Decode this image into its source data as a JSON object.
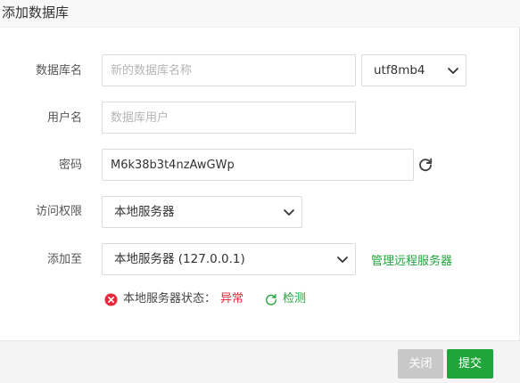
{
  "dialog": {
    "title": "添加数据库"
  },
  "form": {
    "db_name": {
      "label": "数据库名",
      "value": "",
      "placeholder": "新的数据库名称"
    },
    "charset": {
      "selected": "utf8mb4"
    },
    "username": {
      "label": "用户名",
      "value": "",
      "placeholder": "数据库用户"
    },
    "password": {
      "label": "密码",
      "value": "M6k38b3t4nzAwGWp"
    },
    "access": {
      "label": "访问权限",
      "selected": "本地服务器"
    },
    "add_to": {
      "label": "添加至",
      "selected": "本地服务器 (127.0.0.1)",
      "manage_link": "管理远程服务器"
    },
    "status": {
      "label": "本地服务器状态：",
      "value": "异常",
      "check_link": "检测"
    }
  },
  "footer": {
    "close_label": "关闭",
    "submit_label": "提交"
  },
  "colors": {
    "accent_green": "#20a53a",
    "error_red": "#e8283c",
    "disabled_gray": "#c8c8c8"
  },
  "icons": {
    "select_arrow": "chevron-down-icon",
    "refresh": "refresh-icon",
    "error": "error-circle-icon",
    "check": "reload-icon"
  }
}
